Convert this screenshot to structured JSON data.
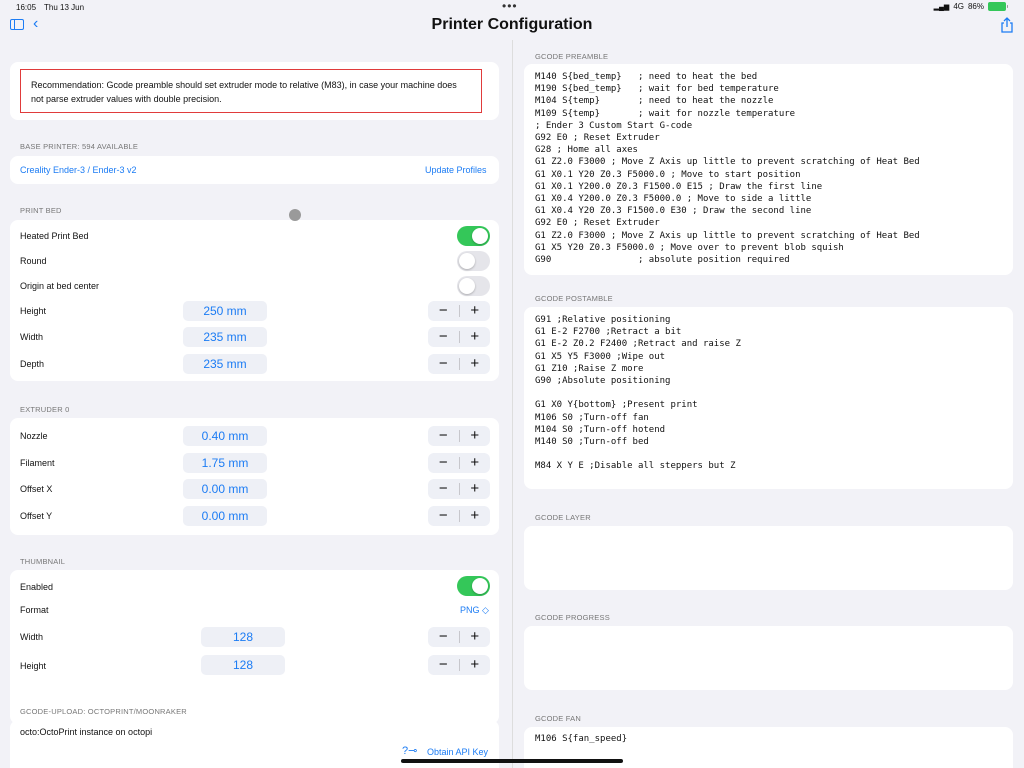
{
  "status": {
    "time": "16:05",
    "date": "Thu 13 Jun",
    "network": "4G",
    "battery": "86%"
  },
  "nav": {
    "title": "Printer Configuration"
  },
  "recommendation": "Recommendation: Gcode preamble should set extruder mode to relative (M83), in case your machine does not parse extruder values with double precision.",
  "base_printer": {
    "header": "BASE PRINTER: 594 AVAILABLE",
    "name": "Creality Ender-3 / Ender-3 v2",
    "update_label": "Update Profiles"
  },
  "print_bed": {
    "header": "PRINT BED",
    "heated_label": "Heated Print Bed",
    "heated": true,
    "round_label": "Round",
    "round": false,
    "origin_label": "Origin at bed center",
    "origin": false,
    "height_label": "Height",
    "height": "250 mm",
    "width_label": "Width",
    "width": "235 mm",
    "depth_label": "Depth",
    "depth": "235 mm"
  },
  "extruder": {
    "header": "EXTRUDER 0",
    "nozzle_label": "Nozzle",
    "nozzle": "0.40 mm",
    "filament_label": "Filament",
    "filament": "1.75 mm",
    "offset_x_label": "Offset X",
    "offset_x": "0.00 mm",
    "offset_y_label": "Offset Y",
    "offset_y": "0.00 mm"
  },
  "thumbnail": {
    "header": "THUMBNAIL",
    "enabled_label": "Enabled",
    "enabled": true,
    "format_label": "Format",
    "format": "PNG ◇",
    "width_label": "Width",
    "width": "128",
    "height_label": "Height",
    "height": "128"
  },
  "upload": {
    "header": "GCODE-UPLOAD: OCTOPRINT/MOONRAKER",
    "instance": "octo:OctoPrint instance on octopi",
    "api_icon": "key-icon",
    "api_label": "Obtain API Key"
  },
  "stepper": {
    "minus": "−",
    "plus": "+"
  },
  "gcode": {
    "preamble_header": "GCODE PREAMBLE",
    "preamble": "M140 S{bed_temp}   ; need to heat the bed\nM190 S{bed_temp}   ; wait for bed temperature\nM104 S{temp}       ; need to heat the nozzle\nM109 S{temp}       ; wait for nozzle temperature\n; Ender 3 Custom Start G-code\nG92 E0 ; Reset Extruder\nG28 ; Home all axes\nG1 Z2.0 F3000 ; Move Z Axis up little to prevent scratching of Heat Bed\nG1 X0.1 Y20 Z0.3 F5000.0 ; Move to start position\nG1 X0.1 Y200.0 Z0.3 F1500.0 E15 ; Draw the first line\nG1 X0.4 Y200.0 Z0.3 F5000.0 ; Move to side a little\nG1 X0.4 Y20 Z0.3 F1500.0 E30 ; Draw the second line\nG92 E0 ; Reset Extruder\nG1 Z2.0 F3000 ; Move Z Axis up little to prevent scratching of Heat Bed\nG1 X5 Y20 Z0.3 F5000.0 ; Move over to prevent blob squish\nG90                ; absolute position required",
    "postamble_header": "GCODE POSTAMBLE",
    "postamble": "G91 ;Relative positioning\nG1 E-2 F2700 ;Retract a bit\nG1 E-2 Z0.2 F2400 ;Retract and raise Z\nG1 X5 Y5 F3000 ;Wipe out\nG1 Z10 ;Raise Z more\nG90 ;Absolute positioning\n\nG1 X0 Y{bottom} ;Present print\nM106 S0 ;Turn-off fan\nM104 S0 ;Turn-off hotend\nM140 S0 ;Turn-off bed\n\nM84 X Y E ;Disable all steppers but Z",
    "layer_header": "GCODE LAYER",
    "layer": "",
    "progress_header": "GCODE PROGRESS",
    "progress": "",
    "fan_header": "GCODE FAN",
    "fan": "M106 S{fan_speed}"
  },
  "colors": {
    "accent": "#1c7cf4",
    "toggle_on": "#34c759",
    "warning_border": "#e03b3b"
  }
}
